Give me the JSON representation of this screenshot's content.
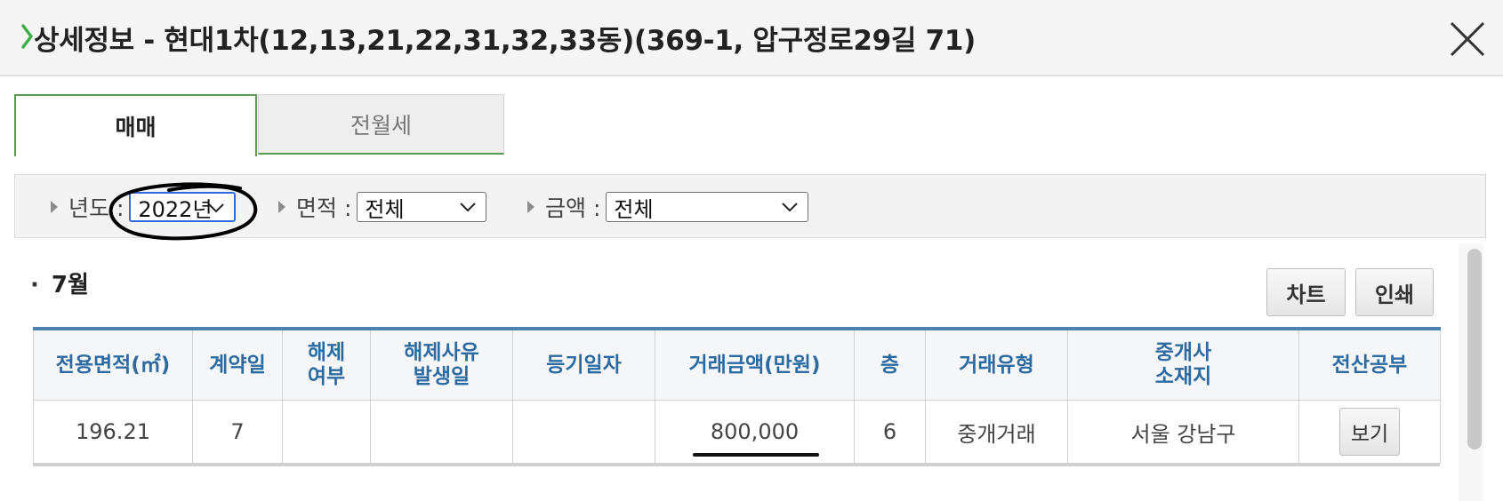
{
  "header": {
    "title": "상세정보 - 현대1차(12,13,21,22,31,32,33동)(369-1, 압구정로29길 71)",
    "close_icon": "close-icon",
    "accent": "#4caf50"
  },
  "tabs": [
    {
      "label": "매매",
      "active": true
    },
    {
      "label": "전월세",
      "active": false
    }
  ],
  "filters": {
    "year": {
      "label": "년도 :",
      "value": "2022년"
    },
    "area": {
      "label": "면적 :",
      "value": "전체"
    },
    "price": {
      "label": "금액 :",
      "value": "전체"
    }
  },
  "section": {
    "dot": "·",
    "month": "7월"
  },
  "actions": {
    "chart_label": "차트",
    "print_label": "인쇄"
  },
  "table": {
    "headers": [
      "전용면적(㎡)",
      "계약일",
      "해제\n여부",
      "해제사유\n발생일",
      "등기일자",
      "거래금액(만원)",
      "층",
      "거래유형",
      "중개사\n소재지",
      "전산공부"
    ],
    "rows": [
      {
        "area": "196.21",
        "contract_day": "7",
        "cancel": "",
        "cancel_date": "",
        "registered": "",
        "price": "800,000",
        "floor": "6",
        "deal_type": "중개거래",
        "broker_location": "서울 강남구",
        "view_label": "보기"
      }
    ]
  },
  "colors": {
    "header_text": "#2d6aa2",
    "table_top_border": "#4a83b0",
    "tab_border": "#5a9b52",
    "focus": "#2f6ae0"
  }
}
